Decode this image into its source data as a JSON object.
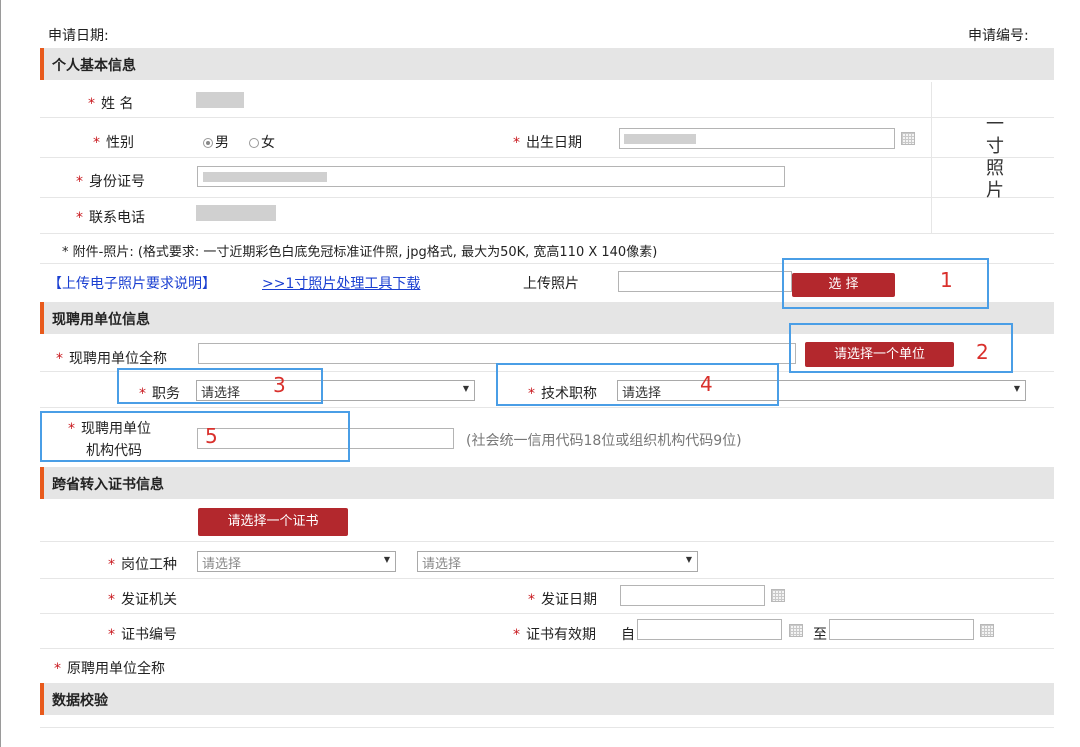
{
  "header": {
    "apply_date_label": "申请日期:",
    "apply_no_label": "申请编号:"
  },
  "sections": {
    "personal": "个人基本信息",
    "employer": "现聘用单位信息",
    "cert": "跨省转入证书信息",
    "verify": "数据校验"
  },
  "personal": {
    "name_label": "姓  名",
    "gender_label": "性别",
    "gender_male": "男",
    "gender_female": "女",
    "gender_selected": "男",
    "birth_label": "出生日期",
    "id_label": "身份证号",
    "phone_label": "联系电话",
    "photo_placeholder": "一寸照片",
    "attachment_note": "* 附件-照片: (格式要求: 一寸近期彩色白底免冠标准证件照, jpg格式, 最大为50K, 宽高110 X 140像素)",
    "photo_req_link": "【上传电子照片要求说明】",
    "photo_tool_link": ">>1寸照片处理工具下载",
    "upload_label": "上传照片",
    "choose_button": "选 择"
  },
  "employer": {
    "fullname_label": "现聘用单位全称",
    "select_unit_button": "请选择一个单位",
    "position_label": "职务",
    "position_value": "请选择",
    "title_label": "技术职称",
    "title_value": "请选择",
    "orgcode_label_1": "现聘用单位",
    "orgcode_label_2": "机构代码",
    "orgcode_hint": "(社会统一信用代码18位或组织机构代码9位)"
  },
  "cert": {
    "select_cert_button": "请选择一个证书",
    "post_label": "岗位工种",
    "post_select_1": "请选择",
    "post_select_2": "请选择",
    "issuer_label": "发证机关",
    "issue_date_label": "发证日期",
    "cert_no_label": "证书编号",
    "validity_label": "证书有效期",
    "validity_from": "自",
    "validity_to": "至",
    "orig_employer_label": "原聘用单位全称"
  },
  "annotations": [
    "1",
    "2",
    "3",
    "4",
    "5"
  ],
  "colors": {
    "accent": "#e85a1c",
    "button": "#b3282d",
    "annotation_box": "#4a9ee6",
    "annotation_text": "#d9302c",
    "required_star": "#c8171d"
  }
}
